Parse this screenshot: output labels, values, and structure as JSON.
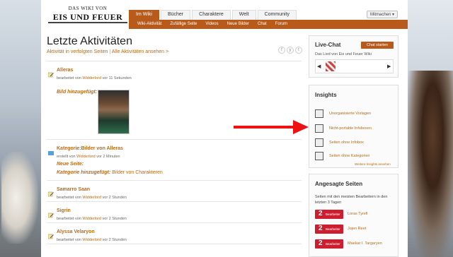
{
  "logo": {
    "line1": "DAS WIKI VON",
    "line2": "EIS UND FEUER"
  },
  "nav": {
    "tabs": [
      "Im Wiki",
      "Bücher",
      "Charaktere",
      "Welt",
      "Community"
    ],
    "active": "Im Wiki"
  },
  "subnav": [
    "Wiki-Aktivität",
    "Zufällige Seite",
    "Videos",
    "Neue Bilder",
    "Chat",
    "Forum"
  ],
  "follow_label": "Mitmachen",
  "page": {
    "title": "Letzte Aktivitäten",
    "link1": "Aktivität in verfolgten Seiten",
    "separator": "|",
    "link2": "Alle Aktivitäten ansehen >",
    "social": [
      "f",
      "y",
      "t"
    ]
  },
  "feed": [
    {
      "name": "Alleras",
      "meta_prefix": "bearbeitet von",
      "user": "Widderlord",
      "meta_suffix": "vor 11 Sekunden",
      "extra_label": "Bild hinzugefügt:"
    },
    {
      "name": "Kategorie:Bilder von Alleras",
      "meta_prefix": "erstellt von",
      "user": "Widderlord",
      "meta_suffix": "vor 2 Minuten",
      "new_page_label": "Neue Seite:",
      "cat_label": "Kategorie hinzugefügt:",
      "cat_value": "Bilder von Charakteren"
    },
    {
      "name": "Samarro Saan",
      "meta_prefix": "bearbeitet von",
      "user": "Widderlord",
      "meta_suffix": "vor 2 Stunden"
    },
    {
      "name": "Sigrin",
      "meta_prefix": "bearbeitet von",
      "user": "Widderlord",
      "meta_suffix": "vor 2 Stunden"
    },
    {
      "name": "Alyssa Velaryon",
      "meta_prefix": "bearbeitet von",
      "user": "Widderlord",
      "meta_suffix": "vor 2 Stunden"
    }
  ],
  "chat": {
    "title": "Live-Chat",
    "button": "Chat starten",
    "subtitle": "Das Lied von Eis und Feuer Wiki"
  },
  "insights": {
    "title": "Insights",
    "items": [
      "Unorganisierte Vorlagen",
      "Nicht-portable Infoboxen",
      "Seiten ohne Infobox",
      "Seiten ohne Kategorien"
    ],
    "more": "Weitere Insights ansehen"
  },
  "angesagt": {
    "title": "Angesagte Seiten",
    "subtitle": "Seiten mit den meisten Bearbeitern in den letzten 3 Tagen",
    "items": [
      {
        "count": "2",
        "label": "Bearbeiter",
        "name": "Loras Tyrell"
      },
      {
        "count": "2",
        "label": "Bearbeiter",
        "name": "Jojen Reet"
      },
      {
        "count": "2",
        "label": "Bearbeiter",
        "name": "Maekar I. Targaryen"
      }
    ]
  },
  "colors": {
    "accent": "#b85a1a",
    "link": "#b86b17",
    "arrow": "#ee1111",
    "badge": "#cc1e2e"
  }
}
